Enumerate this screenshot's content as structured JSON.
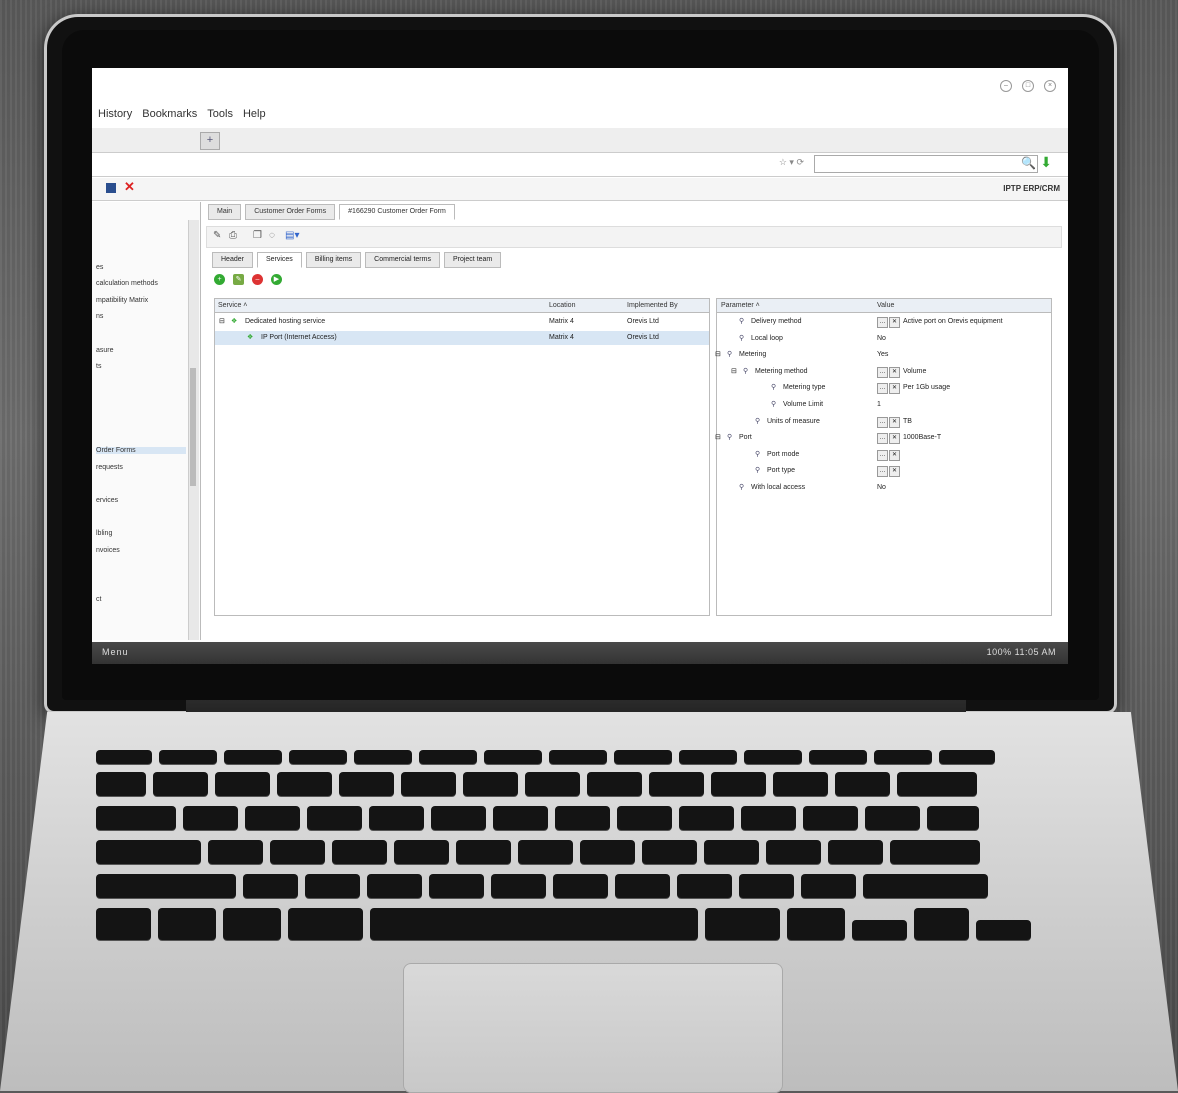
{
  "browser": {
    "menu": [
      "History",
      "Bookmarks",
      "Tools",
      "Help"
    ],
    "tab_add": "+",
    "bookmark_area": "☆ ▾ ⟳"
  },
  "app": {
    "company": "IPTP ERP/CRM",
    "sidebar_items": [
      "es",
      "calculation methods",
      "mpatibility Matrix",
      "ns",
      "asure",
      "ts",
      "Order Forms",
      "requests",
      "ervices",
      "lbling",
      "nvoices",
      "ct"
    ],
    "doc_tabs": [
      "Main",
      "Customer Order Forms",
      "#166290 Customer Order Form"
    ],
    "sub_tabs": [
      "Header",
      "Services",
      "Billing items",
      "Commercial terms",
      "Project team"
    ],
    "services_grid": {
      "columns": [
        "Service ˄",
        "Location",
        "Implemented By"
      ],
      "rows": [
        {
          "service": "Dedicated hosting service",
          "location": "Matrix 4",
          "impl": "Orevis Ltd"
        },
        {
          "service": "IP Port (Internet Access)",
          "location": "Matrix 4",
          "impl": "Orevis Ltd"
        }
      ]
    },
    "params_grid": {
      "columns": [
        "Parameter ˄",
        "Value"
      ],
      "rows": [
        {
          "param": "Delivery method",
          "value": "Active port on Orevis equipment",
          "btns": true
        },
        {
          "param": "Local loop",
          "value": "No",
          "btns": false
        },
        {
          "param": "Metering",
          "value": "Yes",
          "btns": false
        },
        {
          "param": "Metering method",
          "value": "Volume",
          "btns": true
        },
        {
          "param": "Metering type",
          "value": "Per 1Gb usage",
          "btns": true
        },
        {
          "param": "Volume Limit",
          "value": "1",
          "btns": false
        },
        {
          "param": "Units of measure",
          "value": "TB",
          "btns": true
        },
        {
          "param": "Port",
          "value": "1000Base-T",
          "btns": true
        },
        {
          "param": "Port mode",
          "value": "",
          "btns": true
        },
        {
          "param": "Port type",
          "value": "",
          "btns": true
        },
        {
          "param": "With local access",
          "value": "No",
          "btns": false
        }
      ]
    }
  },
  "taskbar": {
    "menu": "Menu",
    "status": "100% 11:05 AM"
  }
}
